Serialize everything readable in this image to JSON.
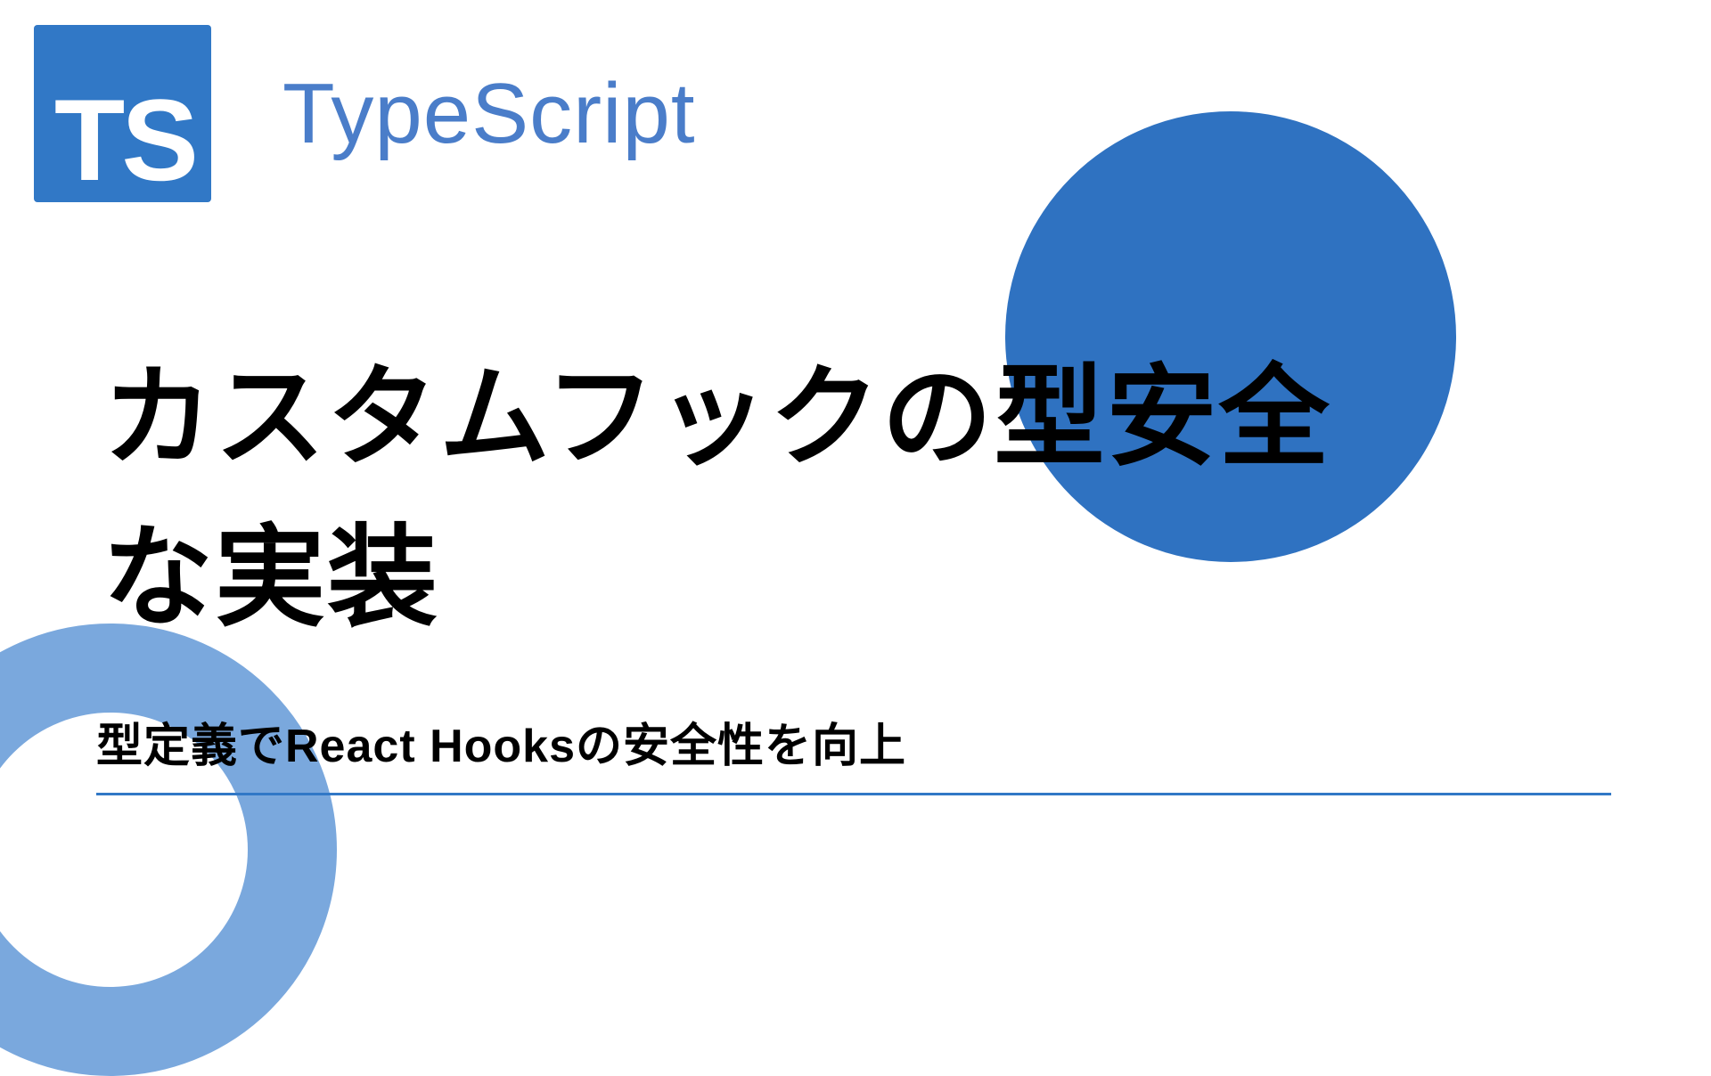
{
  "logo": {
    "badge_text": "TS",
    "label": "TypeScript"
  },
  "main_title": "カスタムフックの型安全な実装",
  "subtitle": "型定義でReact Hooksの安全性を向上",
  "colors": {
    "primary": "#3178c6",
    "accent_light": "#7aa8dd",
    "accent_text": "#4a7dc9",
    "circle_solid": "#2f72c1"
  }
}
